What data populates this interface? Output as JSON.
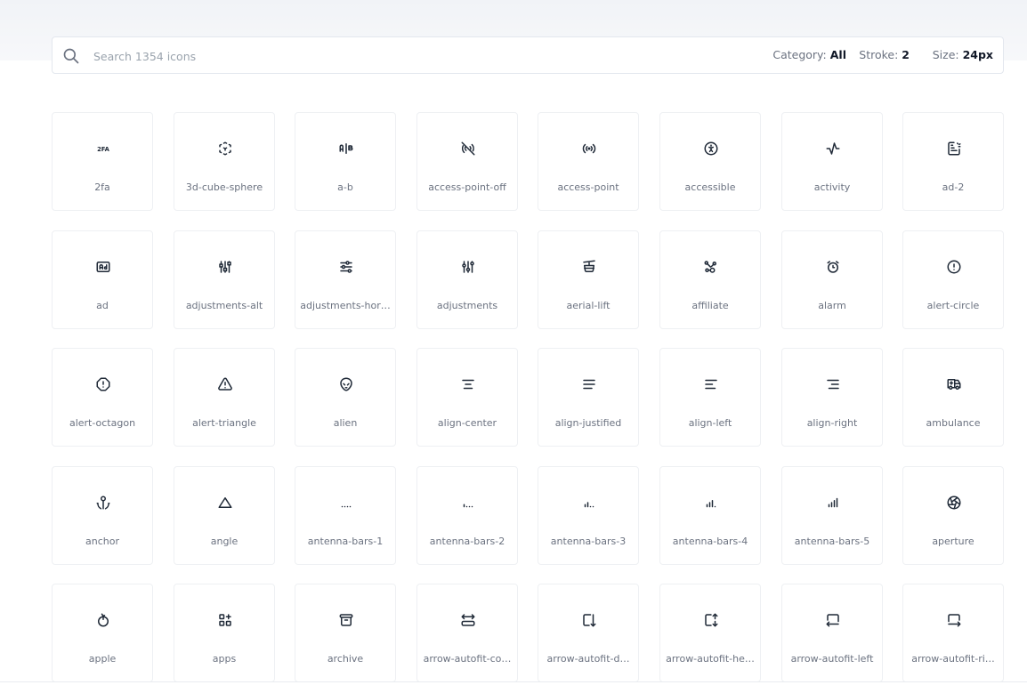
{
  "search": {
    "placeholder": "Search 1354 icons",
    "icon": "search-icon"
  },
  "filters": {
    "category_label": "Category:",
    "category_value": "All",
    "stroke_label": "Stroke:",
    "stroke_value": "2",
    "size_label": "Size:",
    "size_value": "24px"
  },
  "icons": [
    {
      "name": "2fa",
      "icon": "2fa-icon"
    },
    {
      "name": "3d-cube-sphere",
      "icon": "3d-cube-sphere-icon"
    },
    {
      "name": "a-b",
      "icon": "a-b-icon"
    },
    {
      "name": "access-point-off",
      "icon": "access-point-off-icon"
    },
    {
      "name": "access-point",
      "icon": "access-point-icon"
    },
    {
      "name": "accessible",
      "icon": "accessible-icon"
    },
    {
      "name": "activity",
      "icon": "activity-icon"
    },
    {
      "name": "ad-2",
      "icon": "ad-2-icon"
    },
    {
      "name": "ad",
      "icon": "ad-icon"
    },
    {
      "name": "adjustments-alt",
      "icon": "adjustments-alt-icon"
    },
    {
      "name": "adjustments-hor…",
      "icon": "adjustments-horizontal-icon"
    },
    {
      "name": "adjustments",
      "icon": "adjustments-icon"
    },
    {
      "name": "aerial-lift",
      "icon": "aerial-lift-icon"
    },
    {
      "name": "affiliate",
      "icon": "affiliate-icon"
    },
    {
      "name": "alarm",
      "icon": "alarm-icon"
    },
    {
      "name": "alert-circle",
      "icon": "alert-circle-icon"
    },
    {
      "name": "alert-octagon",
      "icon": "alert-octagon-icon"
    },
    {
      "name": "alert-triangle",
      "icon": "alert-triangle-icon"
    },
    {
      "name": "alien",
      "icon": "alien-icon"
    },
    {
      "name": "align-center",
      "icon": "align-center-icon"
    },
    {
      "name": "align-justified",
      "icon": "align-justified-icon"
    },
    {
      "name": "align-left",
      "icon": "align-left-icon"
    },
    {
      "name": "align-right",
      "icon": "align-right-icon"
    },
    {
      "name": "ambulance",
      "icon": "ambulance-icon"
    },
    {
      "name": "anchor",
      "icon": "anchor-icon"
    },
    {
      "name": "angle",
      "icon": "angle-icon"
    },
    {
      "name": "antenna-bars-1",
      "icon": "antenna-bars-1-icon"
    },
    {
      "name": "antenna-bars-2",
      "icon": "antenna-bars-2-icon"
    },
    {
      "name": "antenna-bars-3",
      "icon": "antenna-bars-3-icon"
    },
    {
      "name": "antenna-bars-4",
      "icon": "antenna-bars-4-icon"
    },
    {
      "name": "antenna-bars-5",
      "icon": "antenna-bars-5-icon"
    },
    {
      "name": "aperture",
      "icon": "aperture-icon"
    },
    {
      "name": "apple",
      "icon": "apple-icon"
    },
    {
      "name": "apps",
      "icon": "apps-icon"
    },
    {
      "name": "archive",
      "icon": "archive-icon"
    },
    {
      "name": "arrow-autofit-co…",
      "icon": "arrow-autofit-content-icon"
    },
    {
      "name": "arrow-autofit-d…",
      "icon": "arrow-autofit-down-icon"
    },
    {
      "name": "arrow-autofit-he…",
      "icon": "arrow-autofit-height-icon"
    },
    {
      "name": "arrow-autofit-left",
      "icon": "arrow-autofit-left-icon"
    },
    {
      "name": "arrow-autofit-ri…",
      "icon": "arrow-autofit-right-icon"
    }
  ],
  "colors": {
    "text": "#1f2937",
    "muted": "#6b7280",
    "border": "#eef0f3",
    "icon_stroke": "#1f2937"
  }
}
